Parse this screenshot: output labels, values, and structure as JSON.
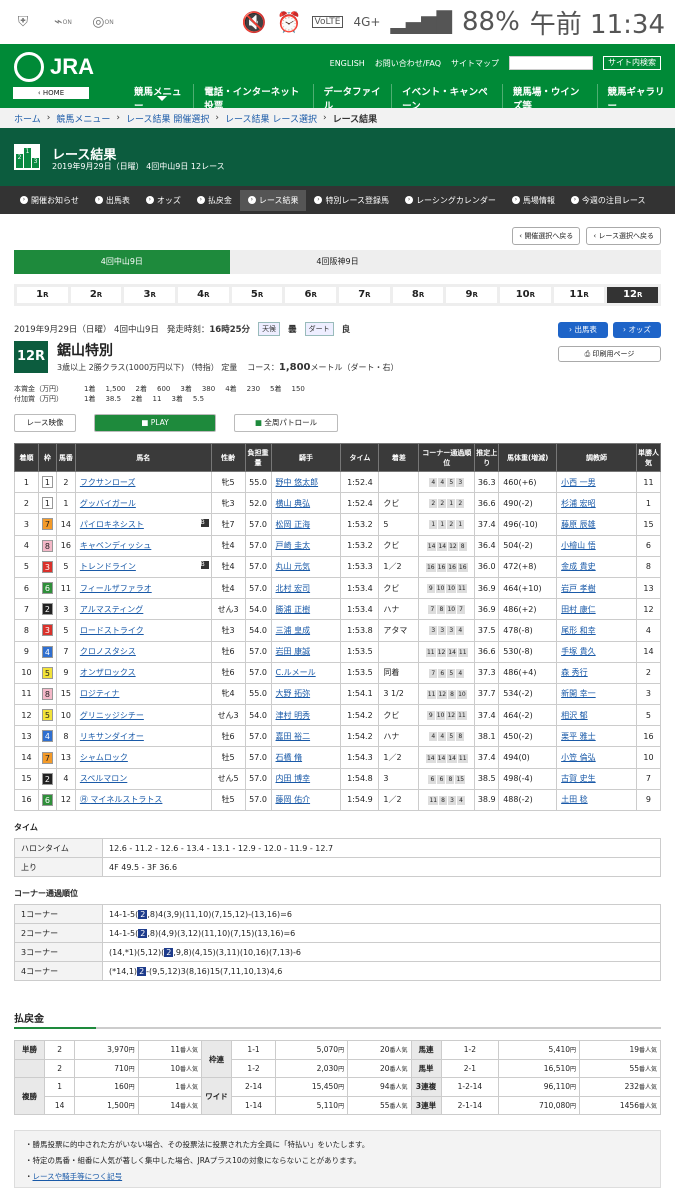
{
  "status": {
    "battery": "88%",
    "time": "午前 11:34",
    "network": "4G+",
    "volte": "VoLTE",
    "on1": "ON",
    "on2": "ON"
  },
  "header": {
    "logo": "JRA",
    "home": "‹ HOME",
    "links": [
      "ENGLISH",
      "お問い合わせ/FAQ",
      "サイトマップ"
    ],
    "search_button": "サイト内検索",
    "nav": [
      "競馬メニュー",
      "電話・インターネット投票",
      "データファイル",
      "イベント・キャンペーン",
      "競馬場・ウインズ等",
      "競馬ギャラリー"
    ]
  },
  "breadcrumb": [
    "ホーム",
    "競馬メニュー",
    "レース結果 開催選択",
    "レース結果 レース選択",
    "レース結果"
  ],
  "title": {
    "main": "レース結果",
    "sub": "2019年9月29日（日曜） 4回中山9日 12レース",
    "icon": [
      "2",
      "1",
      "3"
    ]
  },
  "subnav": [
    "開催お知らせ",
    "出馬表",
    "オッズ",
    "払戻金",
    "レース結果",
    "特別レース登録馬",
    "レーシングカレンダー",
    "馬場情報",
    "今週の注目レース"
  ],
  "select_buttons": [
    "開催選択へ戻る",
    "レース選択へ戻る"
  ],
  "venues": [
    "4回中山9日",
    "4回阪神9日",
    ""
  ],
  "races": [
    "1",
    "2",
    "3",
    "4",
    "5",
    "6",
    "7",
    "8",
    "9",
    "10",
    "11",
    "12"
  ],
  "race_suffix": "R",
  "race": {
    "date": "2019年9月29日（日曜） 4回中山9日",
    "start_label": "発走時刻：",
    "start": "16時25分",
    "weather_label": "天候",
    "weather": "曇",
    "track_label": "ダート",
    "track": "良",
    "num": "12R",
    "name": "鋸山特別",
    "cond": "3歳以上 2勝クラス(1000万円以下) （特指） 定量",
    "course_label": "コース：",
    "course": "1,800",
    "course_unit": "メートル（ダート・右）"
  },
  "buttons": {
    "entry": "出馬表",
    "odds": "オッズ",
    "print": "印刷用ページ"
  },
  "prize": {
    "r1": [
      "本賞金（万円）",
      "1着",
      "1,500",
      "2着",
      "600",
      "3着",
      "380",
      "4着",
      "230",
      "5着",
      "150"
    ],
    "r2": [
      "付加賞（万円）",
      "1着",
      "38.5",
      "2着",
      "11",
      "3着",
      "5.5"
    ]
  },
  "video": {
    "label": "レース映像",
    "play": "PLAY",
    "patrol": "全周パトロール"
  },
  "table": {
    "headers": [
      "着順",
      "枠",
      "馬番",
      "馬名",
      "性齢",
      "負担重量",
      "騎手",
      "タイム",
      "着差",
      "コーナー通過順位",
      "推定上り",
      "馬体重(増減)",
      "調教師",
      "単勝人気"
    ],
    "rows": [
      {
        "pos": "1",
        "waku": "1",
        "wc": "#fff",
        "wt": "#222",
        "num": "2",
        "name": "フクサンローズ",
        "b": "",
        "sex": "牝5",
        "wt2": "55.0",
        "jockey": "野中 悠太郎",
        "time": "1:52.4",
        "margin": "",
        "corner": [
          "4",
          "4",
          "5",
          "3"
        ],
        "up": "36.3",
        "body": "460(+6)",
        "trainer": "小西 一男",
        "pop": "11"
      },
      {
        "pos": "2",
        "waku": "1",
        "wc": "#fff",
        "wt": "#222",
        "num": "1",
        "name": "グッバイガール",
        "b": "",
        "sex": "牝3",
        "wt2": "52.0",
        "jockey": "横山 典弘",
        "time": "1:52.4",
        "margin": "クビ",
        "corner": [
          "2",
          "2",
          "1",
          "2"
        ],
        "up": "36.6",
        "body": "490(-2)",
        "trainer": "杉浦 宏昭",
        "pop": "1"
      },
      {
        "pos": "3",
        "waku": "7",
        "wc": "#f39a29",
        "wt": "#222",
        "num": "14",
        "name": "パイロキネシスト",
        "b": "B",
        "sex": "牡7",
        "wt2": "57.0",
        "jockey": "松岡 正海",
        "time": "1:53.2",
        "margin": "5",
        "corner": [
          "1",
          "1",
          "2",
          "1"
        ],
        "up": "37.4",
        "body": "496(-10)",
        "trainer": "藤原 辰雄",
        "pop": "15"
      },
      {
        "pos": "4",
        "waku": "8",
        "wc": "#f4b8c8",
        "wt": "#222",
        "num": "16",
        "name": "キャベンディッシュ",
        "b": "",
        "sex": "牡4",
        "wt2": "57.0",
        "jockey": "戸崎 圭太",
        "time": "1:53.2",
        "margin": "クビ",
        "corner": [
          "14",
          "14",
          "12",
          "8"
        ],
        "up": "36.4",
        "body": "504(-2)",
        "trainer": "小檜山 悟",
        "pop": "6"
      },
      {
        "pos": "5",
        "waku": "3",
        "wc": "#d9312b",
        "wt": "#fff",
        "num": "5",
        "name": "トレンドライン",
        "b": "B",
        "sex": "牡4",
        "wt2": "57.0",
        "jockey": "丸山 元気",
        "time": "1:53.3",
        "margin": "1／2",
        "corner": [
          "16",
          "16",
          "16",
          "16"
        ],
        "up": "36.0",
        "body": "472(+8)",
        "trainer": "金成 貴史",
        "pop": "8"
      },
      {
        "pos": "6",
        "waku": "6",
        "wc": "#2f8f3a",
        "wt": "#fff",
        "num": "11",
        "name": "フィールザファラオ",
        "b": "",
        "sex": "牡4",
        "wt2": "57.0",
        "jockey": "北村 宏司",
        "time": "1:53.4",
        "margin": "クビ",
        "corner": [
          "9",
          "10",
          "10",
          "11"
        ],
        "up": "36.9",
        "body": "464(+10)",
        "trainer": "岩戸 孝樹",
        "pop": "13"
      },
      {
        "pos": "7",
        "waku": "2",
        "wc": "#222",
        "wt": "#fff",
        "num": "3",
        "name": "アルマスティング",
        "b": "",
        "sex": "せん3",
        "wt2": "54.0",
        "jockey": "勝浦 正樹",
        "time": "1:53.4",
        "margin": "ハナ",
        "corner": [
          "7",
          "8",
          "10",
          "7"
        ],
        "up": "36.9",
        "body": "486(+2)",
        "trainer": "田村 康仁",
        "pop": "12"
      },
      {
        "pos": "8",
        "waku": "3",
        "wc": "#d9312b",
        "wt": "#fff",
        "num": "5",
        "name": "ロードストライク",
        "b": "",
        "sex": "牡3",
        "wt2": "54.0",
        "jockey": "三浦 皇成",
        "time": "1:53.8",
        "margin": "アタマ",
        "corner": [
          "3",
          "3",
          "3",
          "4"
        ],
        "up": "37.5",
        "body": "478(-8)",
        "trainer": "尾形 和幸",
        "pop": "4"
      },
      {
        "pos": "9",
        "waku": "4",
        "wc": "#2f6fd0",
        "wt": "#fff",
        "num": "7",
        "name": "クロノスタシス",
        "b": "",
        "sex": "牡6",
        "wt2": "57.0",
        "jockey": "岩田 康誠",
        "time": "1:53.5",
        "margin": "",
        "corner": [
          "11",
          "12",
          "14",
          "11"
        ],
        "up": "36.6",
        "body": "530(-8)",
        "trainer": "手塚 貴久",
        "pop": "14"
      },
      {
        "pos": "10",
        "waku": "5",
        "wc": "#f2e23a",
        "wt": "#222",
        "num": "9",
        "name": "オンザロックス",
        "b": "",
        "sex": "牡6",
        "wt2": "57.0",
        "jockey": "C.ルメール",
        "time": "1:53.5",
        "margin": "同着",
        "corner": [
          "7",
          "6",
          "5",
          "4"
        ],
        "up": "37.3",
        "body": "486(+4)",
        "trainer": "森 秀行",
        "pop": "2"
      },
      {
        "pos": "11",
        "waku": "8",
        "wc": "#f4b8c8",
        "wt": "#222",
        "num": "15",
        "name": "ロジティナ",
        "b": "",
        "sex": "牝4",
        "wt2": "55.0",
        "jockey": "大野 拓弥",
        "time": "1:54.1",
        "margin": "3 1/2",
        "corner": [
          "11",
          "12",
          "8",
          "10"
        ],
        "up": "37.7",
        "body": "534(-2)",
        "trainer": "新開 幸一",
        "pop": "3"
      },
      {
        "pos": "12",
        "waku": "5",
        "wc": "#f2e23a",
        "wt": "#222",
        "num": "10",
        "name": "グリニッジシチー",
        "b": "",
        "sex": "せん3",
        "wt2": "54.0",
        "jockey": "津村 明秀",
        "time": "1:54.2",
        "margin": "クビ",
        "corner": [
          "9",
          "10",
          "12",
          "11"
        ],
        "up": "37.4",
        "body": "464(-2)",
        "trainer": "相沢 郁",
        "pop": "5"
      },
      {
        "pos": "13",
        "waku": "4",
        "wc": "#2f6fd0",
        "wt": "#fff",
        "num": "8",
        "name": "リキサンダイオー",
        "b": "",
        "sex": "牡6",
        "wt2": "57.0",
        "jockey": "嘉田 裕二",
        "time": "1:54.2",
        "margin": "ハナ",
        "corner": [
          "4",
          "4",
          "5",
          "8"
        ],
        "up": "38.1",
        "body": "450(-2)",
        "trainer": "栗平 雅士",
        "pop": "16"
      },
      {
        "pos": "14",
        "waku": "7",
        "wc": "#f39a29",
        "wt": "#222",
        "num": "13",
        "name": "シャムロック",
        "b": "",
        "sex": "牡5",
        "wt2": "57.0",
        "jockey": "石橋 脩",
        "time": "1:54.3",
        "margin": "1／2",
        "corner": [
          "14",
          "14",
          "14",
          "11"
        ],
        "up": "37.4",
        "body": "494(0)",
        "trainer": "小笠 倫弘",
        "pop": "10"
      },
      {
        "pos": "15",
        "waku": "2",
        "wc": "#222",
        "wt": "#fff",
        "num": "4",
        "name": "スペルマロン",
        "b": "",
        "sex": "せん5",
        "wt2": "57.0",
        "jockey": "内田 博幸",
        "time": "1:54.8",
        "margin": "3",
        "corner": [
          "6",
          "6",
          "8",
          "15"
        ],
        "up": "38.5",
        "body": "498(-4)",
        "trainer": "古賀 史生",
        "pop": "7"
      },
      {
        "pos": "16",
        "waku": "6",
        "wc": "#2f8f3a",
        "wt": "#fff",
        "num": "12",
        "name": "マイネルストラトス",
        "b": "",
        "sex": "牡5",
        "wt2": "57.0",
        "jockey": "藤岡 佑介",
        "time": "1:54.9",
        "margin": "1／2",
        "corner": [
          "11",
          "8",
          "3",
          "4"
        ],
        "up": "38.9",
        "body": "488(-2)",
        "trainer": "土田 稔",
        "pop": "9"
      }
    ]
  },
  "time_section": {
    "title": "タイム",
    "rows": [
      [
        "ハロンタイム",
        "12.6 - 11.2 - 12.6 - 13.4 - 13.1 - 12.9 - 12.0 - 11.9 - 12.7"
      ],
      [
        "上り",
        "4F 49.5 - 3F 36.6"
      ]
    ]
  },
  "corner_section": {
    "title": "コーナー通過順位",
    "rows": [
      [
        "1コーナー",
        "14-1-5(",
        "2",
        ",8)4(3,9)(11,10)(7,15,12)-(13,16)=6"
      ],
      [
        "2コーナー",
        "14-1-5(",
        "2",
        ",8)(4,9)(3,12)(11,10)(7,15)(13,16)=6"
      ],
      [
        "3コーナー",
        "(14,*1)(5,12)(",
        "2",
        ",9,8)(4,15)(3,11)(10,16)(7,13)-6"
      ],
      [
        "4コーナー",
        "(*14,1)",
        "2",
        "-(9,5,12)3(8,16)15(7,11,10,13)4,6"
      ]
    ]
  },
  "payout": {
    "title": "払戻金",
    "pop_suffix": "番人気",
    "yen": "円",
    "rows": [
      [
        "単勝",
        "2",
        "3,970",
        "11",
        "枠連",
        "1-1",
        "5,070",
        "20",
        "馬連",
        "1-2",
        "5,410",
        "19"
      ],
      [
        "",
        "2",
        "710",
        "10",
        "",
        "1-2",
        "2,030",
        "20",
        "馬単",
        "2-1",
        "16,510",
        "55"
      ],
      [
        "複勝",
        "1",
        "160",
        "1",
        "ワイド",
        "2-14",
        "15,450",
        "94",
        "3連複",
        "1-2-14",
        "96,110",
        "232"
      ],
      [
        "",
        "14",
        "1,500",
        "14",
        "",
        "1-14",
        "5,110",
        "55",
        "3連単",
        "2-1-14",
        "710,080",
        "1456"
      ]
    ]
  },
  "notes": {
    "n1": "勝馬投票に的中された方がいない場合、その投票法に投票された方全員に「特払い」をいたします。",
    "n2": "特定の馬番・組番に人気が著しく集中した場合、JRAプラス10の対象にならないことがあります。",
    "n3": "レースや騎手等につく記号"
  }
}
